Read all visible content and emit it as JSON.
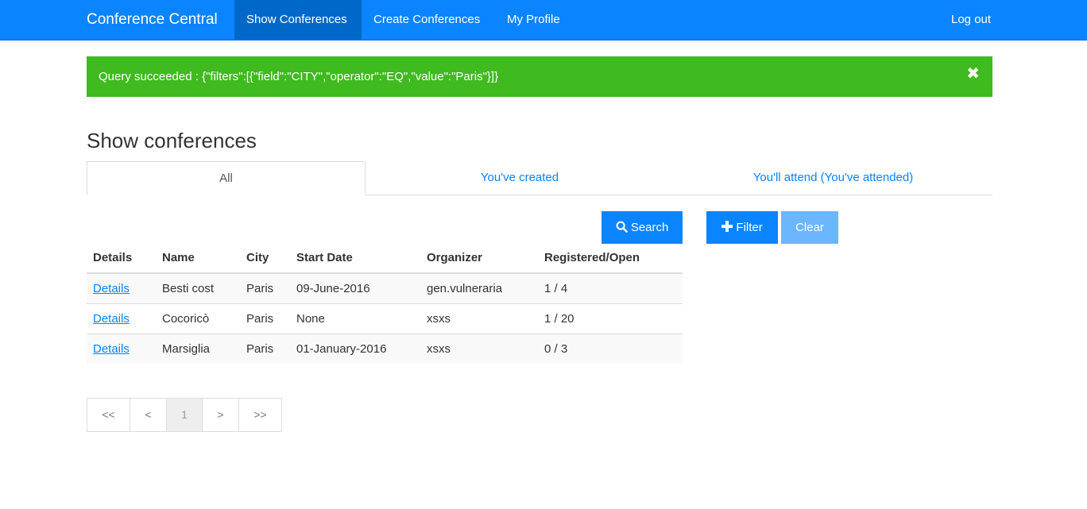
{
  "navbar": {
    "brand": "Conference Central",
    "links": [
      "Show Conferences",
      "Create Conferences",
      "My Profile"
    ],
    "logout": "Log out"
  },
  "alert": {
    "message": "Query succeeded : {\"filters\":[{\"field\":\"CITY\",\"operator\":\"EQ\",\"value\":\"Paris\"}]}",
    "close_icon": "close-icon"
  },
  "page": {
    "title": "Show conferences"
  },
  "tabs": [
    "All",
    "You've created",
    "You'll attend (You've attended)"
  ],
  "buttons": {
    "search": "Search",
    "filter": "Filter",
    "clear": "Clear"
  },
  "table": {
    "headers": [
      "Details",
      "Name",
      "City",
      "Start Date",
      "Organizer",
      "Registered/Open"
    ],
    "rows": [
      [
        "Details",
        "Besti cost",
        "Paris",
        "09-June-2016",
        "gen.vulneraria",
        "1 / 4"
      ],
      [
        "Details",
        "Cocoricò",
        "Paris",
        "None",
        "xsxs",
        "1 / 20"
      ],
      [
        "Details",
        "Marsiglia",
        "Paris",
        "01-January-2016",
        "xsxs",
        "0 / 3"
      ]
    ]
  },
  "pagination": [
    "<<",
    "<",
    "1",
    ">",
    ">>"
  ],
  "colors": {
    "primary": "#0a84ff",
    "success": "#3fba1f"
  }
}
